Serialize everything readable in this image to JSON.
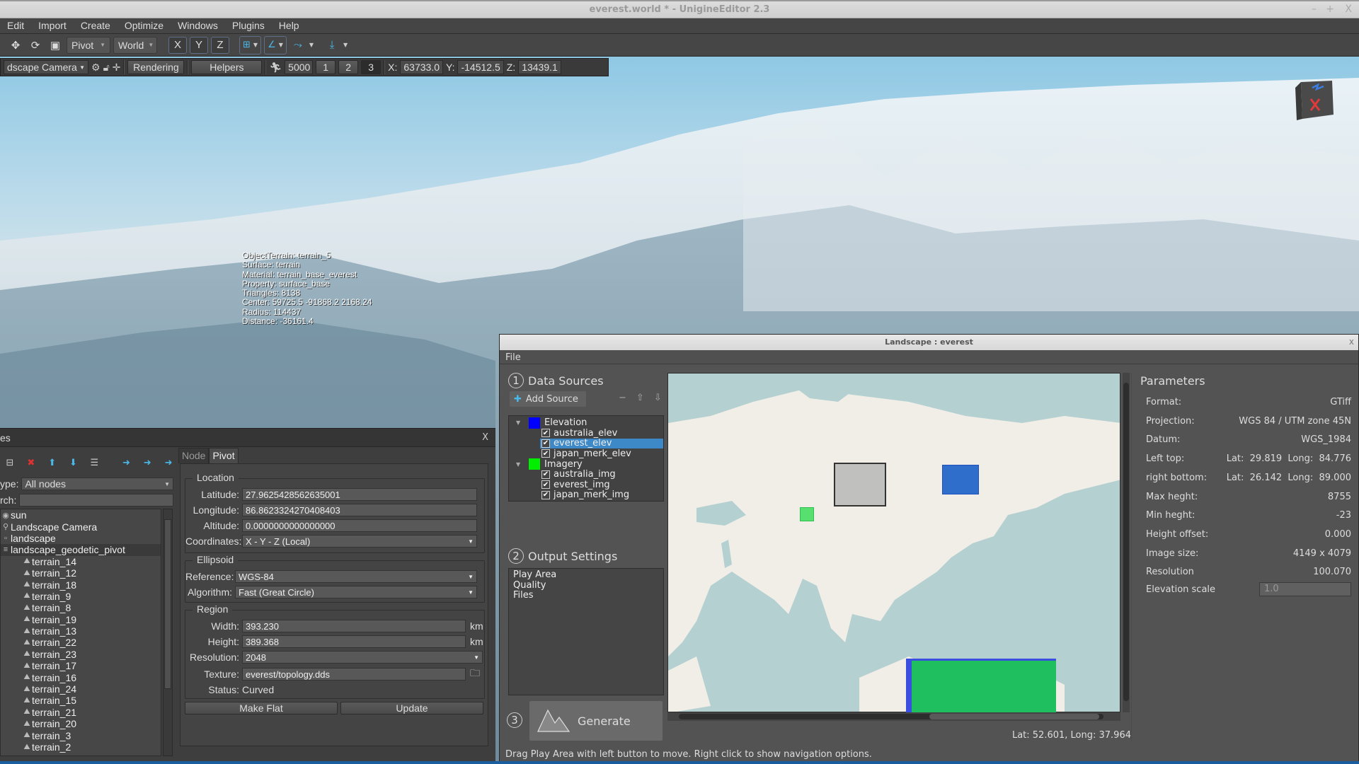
{
  "window": {
    "title": "everest.world * - UnigineEditor 2.3",
    "controls": [
      "–",
      "+",
      "X"
    ]
  },
  "menubar": {
    "items": [
      "Edit",
      "Import",
      "Create",
      "Optimize",
      "Windows",
      "Plugins",
      "Help"
    ]
  },
  "toolbar": {
    "pivot_combo": "Pivot",
    "space_combo": "World",
    "axis_x": "X",
    "axis_y": "Y",
    "axis_z": "Z"
  },
  "camera_toolbar": {
    "camera": "dscape Camera",
    "rendering": "Rendering",
    "helpers": "Helpers",
    "speed": "5000",
    "speed_presets": [
      "1",
      "2",
      "3"
    ],
    "x_label": "X:",
    "x": "63733.0",
    "y_label": "Y:",
    "y": "-14512.5",
    "z_label": "Z:",
    "z": "13439.1"
  },
  "viewport_info": {
    "lines": [
      "ObjectTerrain: terrain_5",
      "Surface: terrain",
      "Material: terrain_base_everest",
      "Property: surface_base",
      "Triangles: 8138",
      "Center: 59725.5 -91868.2 2168.24",
      "Radius: 114437",
      "Distance: -36161.4"
    ]
  },
  "nodes_panel": {
    "title": "es",
    "close": "X",
    "type_label": "ype:",
    "type_value": "All nodes",
    "search_label": "rch:",
    "search_value": "",
    "tree": [
      {
        "label": "sun",
        "icon": "sun-icon",
        "depth": 0
      },
      {
        "label": "Landscape Camera",
        "icon": "camera-icon",
        "depth": 0
      },
      {
        "label": "landscape",
        "icon": "node-icon",
        "depth": 0
      },
      {
        "label": "landscape_geodetic_pivot",
        "icon": "pivot-icon",
        "depth": 0,
        "selected": true
      },
      {
        "label": "terrain_14",
        "icon": "terrain-icon",
        "depth": 1
      },
      {
        "label": "terrain_12",
        "icon": "terrain-icon",
        "depth": 1
      },
      {
        "label": "terrain_18",
        "icon": "terrain-icon",
        "depth": 1
      },
      {
        "label": "terrain_9",
        "icon": "terrain-icon",
        "depth": 1
      },
      {
        "label": "terrain_8",
        "icon": "terrain-icon",
        "depth": 1
      },
      {
        "label": "terrain_19",
        "icon": "terrain-icon",
        "depth": 1
      },
      {
        "label": "terrain_13",
        "icon": "terrain-icon",
        "depth": 1
      },
      {
        "label": "terrain_22",
        "icon": "terrain-icon",
        "depth": 1
      },
      {
        "label": "terrain_23",
        "icon": "terrain-icon",
        "depth": 1
      },
      {
        "label": "terrain_17",
        "icon": "terrain-icon",
        "depth": 1
      },
      {
        "label": "terrain_16",
        "icon": "terrain-icon",
        "depth": 1
      },
      {
        "label": "terrain_24",
        "icon": "terrain-icon",
        "depth": 1
      },
      {
        "label": "terrain_15",
        "icon": "terrain-icon",
        "depth": 1
      },
      {
        "label": "terrain_21",
        "icon": "terrain-icon",
        "depth": 1
      },
      {
        "label": "terrain_20",
        "icon": "terrain-icon",
        "depth": 1
      },
      {
        "label": "terrain_3",
        "icon": "terrain-icon",
        "depth": 1
      },
      {
        "label": "terrain_2",
        "icon": "terrain-icon",
        "depth": 1
      }
    ]
  },
  "pivot_panel": {
    "tabs": [
      "Node",
      "Pivot"
    ],
    "active_tab": "Pivot",
    "location": {
      "title": "Location",
      "latitude_label": "Latitude:",
      "latitude": "27.9625428562635001",
      "longitude_label": "Longitude:",
      "longitude": "86.8623324270408403",
      "altitude_label": "Altitude:",
      "altitude": "0.0000000000000000",
      "coordinates_label": "Coordinates:",
      "coordinates": "X - Y - Z (Local)"
    },
    "ellipsoid": {
      "title": "Ellipsoid",
      "reference_label": "Reference:",
      "reference": "WGS-84",
      "algorithm_label": "Algorithm:",
      "algorithm": "Fast (Great Circle)"
    },
    "region": {
      "title": "Region",
      "width_label": "Width:",
      "width": "393.230",
      "width_unit": "km",
      "height_label": "Height:",
      "height": "389.368",
      "height_unit": "km",
      "resolution_label": "Resolution:",
      "resolution": "2048",
      "texture_label": "Texture:",
      "texture": "everest/topology.dds",
      "status_label": "Status:",
      "status": "Curved"
    },
    "make_flat": "Make Flat",
    "update": "Update"
  },
  "landscape_dialog": {
    "title": "Landscape : everest",
    "close": "x",
    "menu_file": "File",
    "step1_num": "1",
    "step1": "Data Sources",
    "add_source": "Add Source",
    "groups": [
      {
        "name": "Elevation",
        "color": "#0000ff",
        "items": [
          {
            "label": "australia_elev",
            "checked": true
          },
          {
            "label": "everest_elev",
            "checked": true,
            "selected": true
          },
          {
            "label": "japan_merk_elev",
            "checked": true
          }
        ]
      },
      {
        "name": "Imagery",
        "color": "#00ee00",
        "items": [
          {
            "label": "australia_img",
            "checked": true
          },
          {
            "label": "everest_img",
            "checked": true
          },
          {
            "label": "japan_merk_img",
            "checked": true
          }
        ]
      }
    ],
    "step2_num": "2",
    "step2": "Output Settings",
    "output_items": [
      "Play Area",
      "Quality",
      "Files"
    ],
    "step3_num": "3",
    "generate": "Generate",
    "status": "Drag Play Area with left button to move. Right click to show navigation options.",
    "map_coords": "Lat: 52.601, Long: 37.964",
    "parameters": {
      "title": "Parameters",
      "rows": [
        {
          "label": "Format:",
          "value": "GTiff"
        },
        {
          "label": "Projection:",
          "value": "WGS 84 / UTM zone 45N"
        },
        {
          "label": "Datum:",
          "value": "WGS_1984"
        },
        {
          "label": "Left top:",
          "value": "Lat:  29.819  Long:  84.776"
        },
        {
          "label": "right bottom:",
          "value": "Lat:  26.142  Long:  89.000"
        },
        {
          "label": "Max heght:",
          "value": "8755"
        },
        {
          "label": "Min heght:",
          "value": "-23"
        },
        {
          "label": "Height offset:",
          "value": "0.000"
        },
        {
          "label": "Image size:",
          "value": "4149 x 4079"
        },
        {
          "label": "Resolution",
          "value": "100.070"
        }
      ],
      "elevation_scale_label": "Elevation scale",
      "elevation_scale": "1.0"
    }
  },
  "colors": {
    "selection": "#3d88c6",
    "elevation": "#0000ff",
    "imagery": "#00ee00"
  }
}
